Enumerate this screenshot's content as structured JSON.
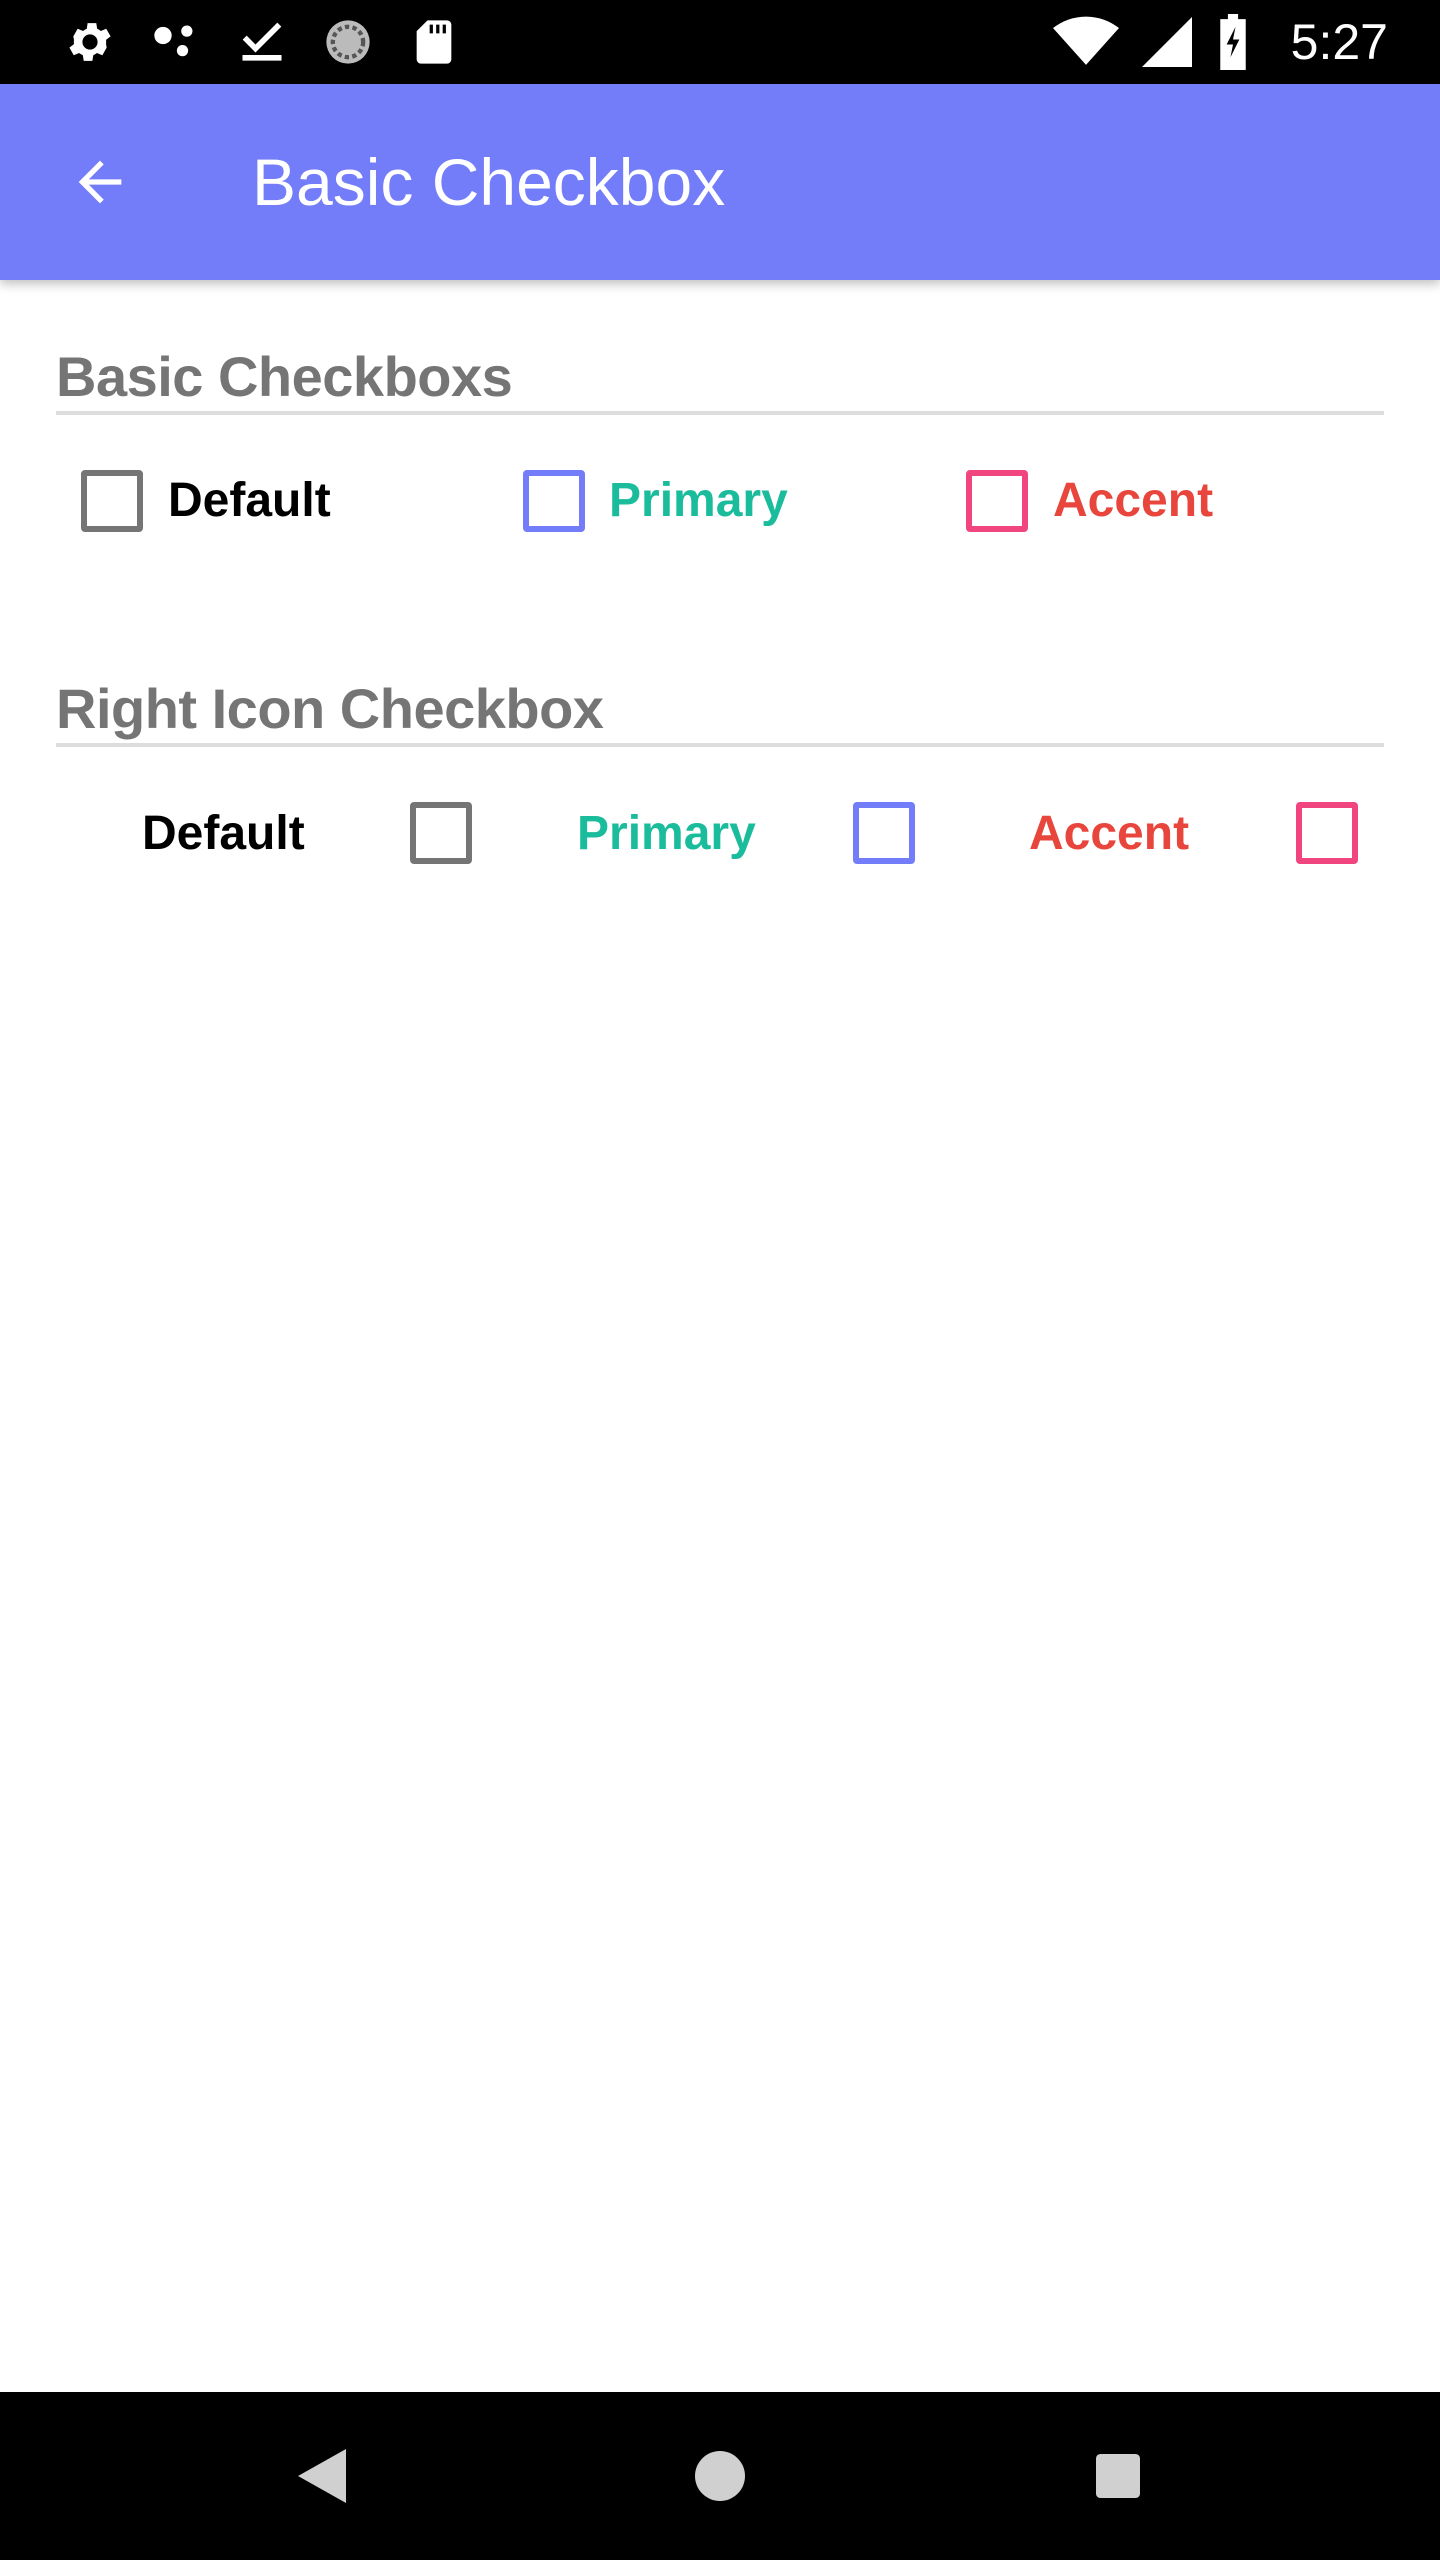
{
  "status_bar": {
    "time": "5:27",
    "icons_left": [
      "settings-icon",
      "dots-icon",
      "download-done-icon",
      "sync-icon",
      "sd-card-icon"
    ],
    "icons_right": [
      "wifi-icon",
      "signal-icon",
      "battery-charging-icon"
    ]
  },
  "app_bar": {
    "title": "Basic Checkbox",
    "back_icon": "arrow-back-icon",
    "color": "#737cf9"
  },
  "sections": [
    {
      "title": "Basic Checkboxs",
      "items": [
        {
          "label": "Default",
          "checked": false,
          "box_color": "#757575",
          "label_color": "#000000"
        },
        {
          "label": "Primary",
          "checked": false,
          "box_color": "#737cf9",
          "label_color": "#1abc9c"
        },
        {
          "label": "Accent",
          "checked": false,
          "box_color": "#f0457f",
          "label_color": "#e8453c"
        }
      ]
    },
    {
      "title": "Right Icon Checkbox",
      "items": [
        {
          "label": "Default",
          "checked": false,
          "box_color": "#757575",
          "label_color": "#000000"
        },
        {
          "label": "Primary",
          "checked": false,
          "box_color": "#737cf9",
          "label_color": "#1abc9c"
        },
        {
          "label": "Accent",
          "checked": false,
          "box_color": "#f0457f",
          "label_color": "#e8453c"
        }
      ]
    }
  ],
  "nav_bar": {
    "buttons": [
      "back-triangle-icon",
      "home-circle-icon",
      "recents-square-icon"
    ]
  }
}
